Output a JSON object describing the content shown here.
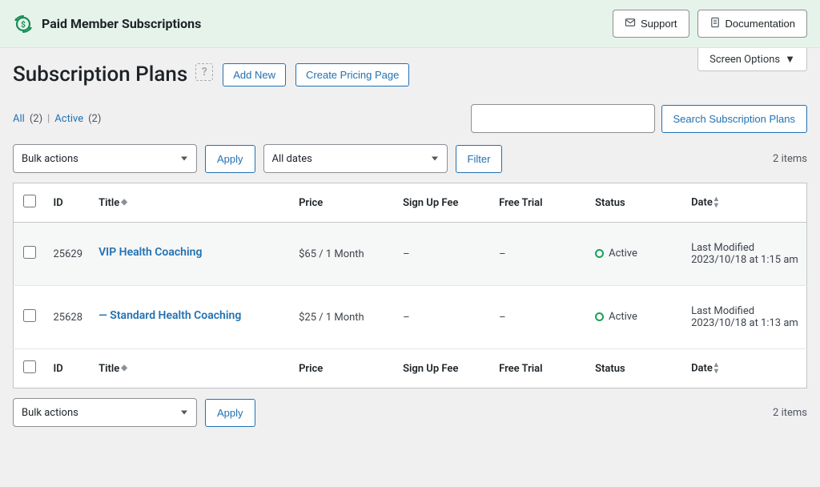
{
  "header": {
    "brand": "Paid Member Subscriptions",
    "support": "Support",
    "documentation": "Documentation"
  },
  "page": {
    "title": "Subscription Plans",
    "add_new": "Add New",
    "create_pricing_page": "Create Pricing Page",
    "screen_options": "Screen Options"
  },
  "subsubsub": {
    "all_label": "All",
    "all_count": "(2)",
    "active_label": "Active",
    "active_count": "(2)"
  },
  "search": {
    "button": "Search Subscription Plans"
  },
  "bulk": {
    "bulk_actions": "Bulk actions",
    "apply": "Apply",
    "all_dates": "All dates",
    "filter": "Filter"
  },
  "items_count": "2 items",
  "columns": {
    "id": "ID",
    "title": "Title",
    "price": "Price",
    "signup": "Sign Up Fee",
    "trial": "Free Trial",
    "status": "Status",
    "date": "Date"
  },
  "rows": [
    {
      "id": "25629",
      "title": "VIP Health Coaching",
      "title_prefix": "",
      "price": "$65 / 1 Month",
      "signup": "–",
      "trial": "–",
      "status": "Active",
      "date_label": "Last Modified",
      "date_value": "2023/10/18 at 1:15 am"
    },
    {
      "id": "25628",
      "title": "— Standard Health Coaching",
      "title_prefix": "",
      "price": "$25 / 1 Month",
      "signup": "–",
      "trial": "–",
      "status": "Active",
      "date_label": "Last Modified",
      "date_value": "2023/10/18 at 1:13 am"
    }
  ]
}
